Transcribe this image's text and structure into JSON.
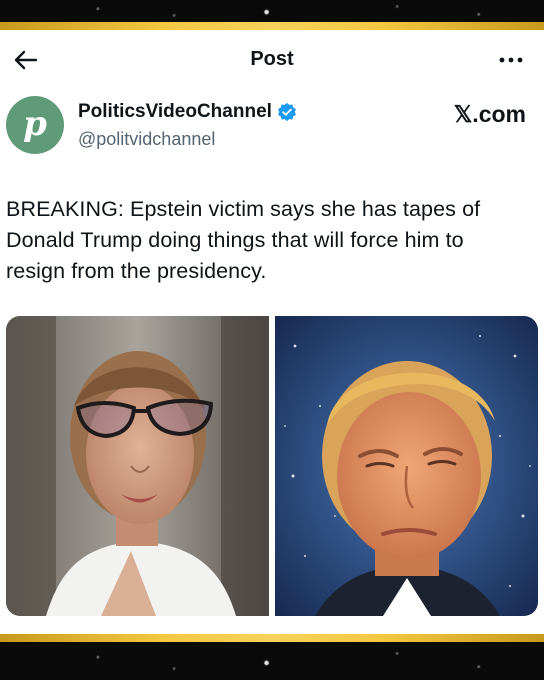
{
  "topbar": {
    "title": "Post",
    "back_icon": "arrow-left-icon",
    "more_icon": "more-horizontal-icon"
  },
  "author": {
    "display_name": "PoliticsVideoChannel",
    "handle": "@politvidchannel",
    "avatar_letter": "p",
    "avatar_color": "#5f9b78",
    "verified": true,
    "verified_color": "#1d9bf0"
  },
  "site_brand": "𝕏.com",
  "post": {
    "lines": [
      "BREAKING: Epstein victim says she has tapes of",
      "Donald Trump doing things that will force him to",
      "resign from the presidency."
    ]
  },
  "media": [
    {
      "subject": "woman-with-glasses-photo"
    },
    {
      "subject": "man-on-starry-background-photo"
    }
  ],
  "colors": {
    "accent_gold": "#f5c842",
    "frame_dark": "#0a0a0a",
    "text_primary": "#0f1419",
    "text_secondary": "#536471"
  }
}
